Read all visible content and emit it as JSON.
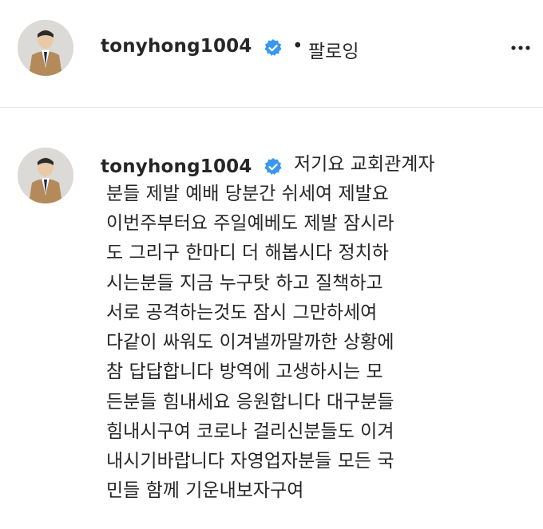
{
  "header": {
    "username": "tonyhong1004",
    "separator": "•",
    "follow_label": "팔로잉",
    "more_icon": "more-horizontal-icon"
  },
  "comment": {
    "username": "tonyhong1004",
    "verified_icon": "verified-badge-icon",
    "lines": [
      "저기요 교회관계자",
      "분들 제발 예배 당분간 쉬세여 제발요",
      "이번주부터요 주일예베도 제발 잠시라",
      "도 그리구 한마디 더 해봅시다 정치하",
      "시는분들 지금 누구탓 하고 질책하고",
      "서로 공격하는것도 잠시 그만하세여",
      "다같이 싸워도 이겨낼까말까한 상황에",
      "참 답답합니다 방역에 고생하시는 모",
      "든분들 힘내세요 응원합니다 대구분들",
      "힘내시구여 코로나 걸리신분들도 이겨",
      "내시기바랍니다 자영업자분들 모든 국",
      "민들 함께 기운내보자구여"
    ]
  },
  "colors": {
    "text": "#262626",
    "verified": "#3897f0",
    "divider": "#e6e6e6"
  }
}
